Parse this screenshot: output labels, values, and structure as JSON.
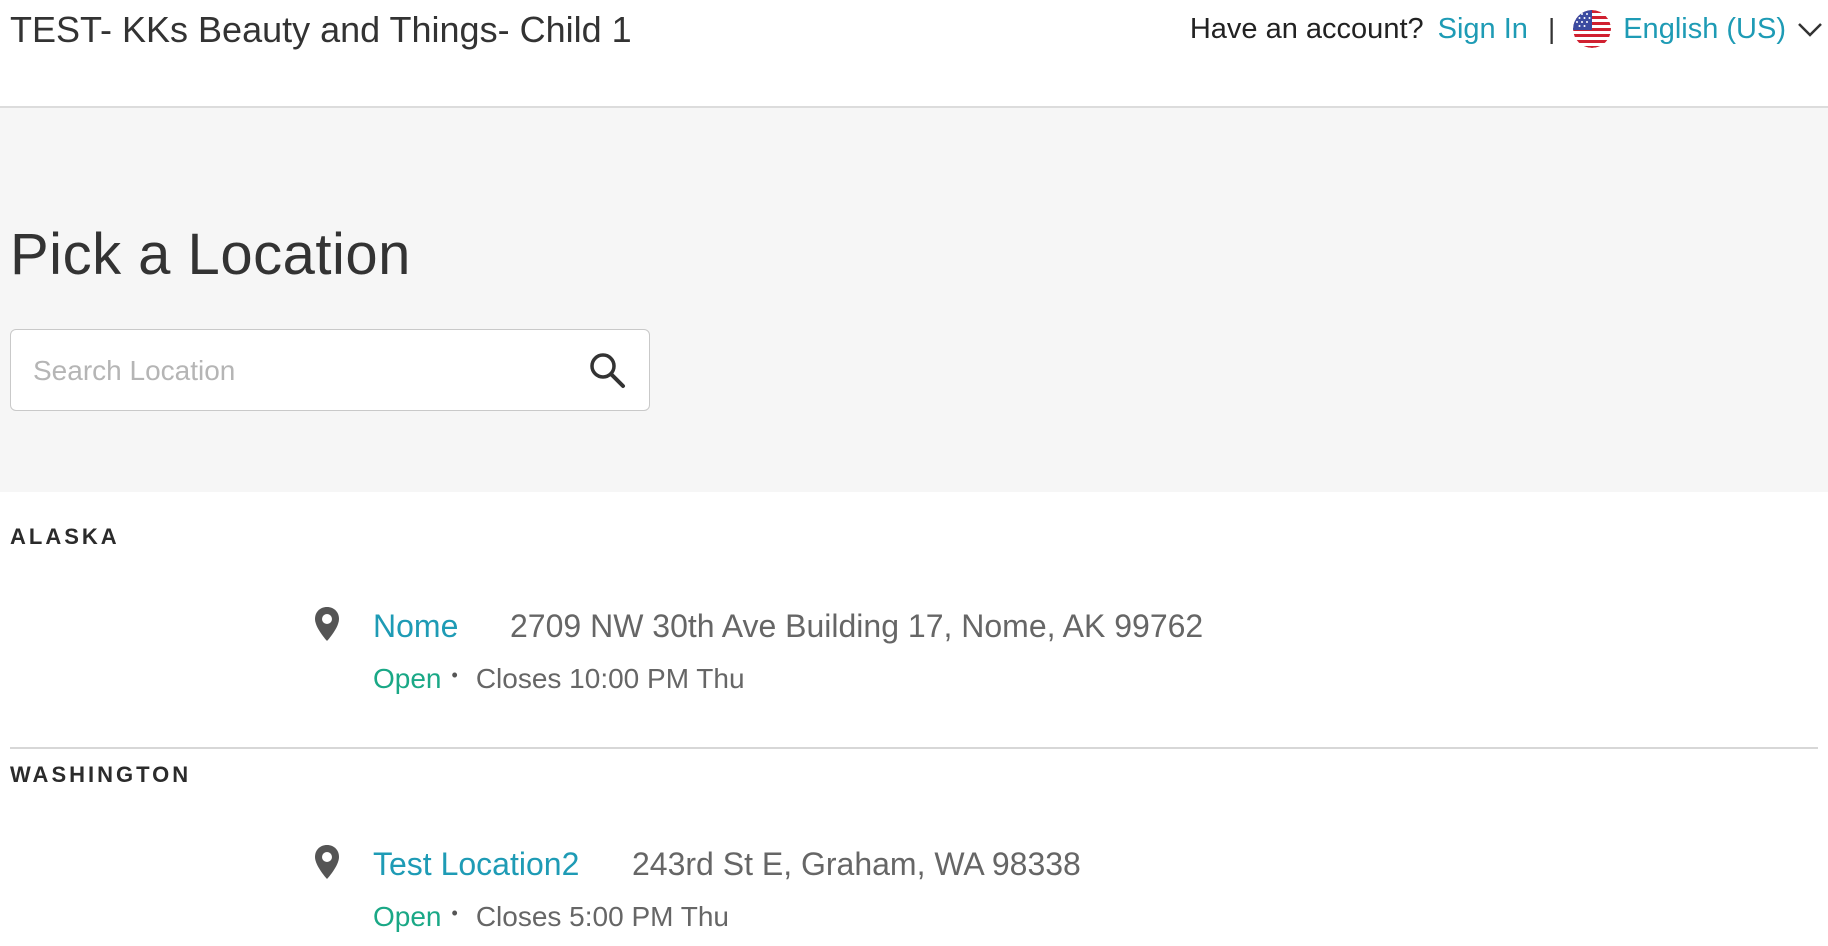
{
  "header": {
    "title": "TEST- KKs Beauty and Things- Child 1",
    "have_account": "Have an account?",
    "sign_in": "Sign In",
    "separator": "|",
    "language": "English (US)",
    "flag_icon": "us-flag-icon",
    "dropdown_icon": "chevron-down-icon"
  },
  "hero": {
    "title": "Pick a Location",
    "search": {
      "placeholder": "Search Location",
      "value": "",
      "icon": "search-icon"
    }
  },
  "regions": [
    {
      "heading": "ALASKA",
      "locations": [
        {
          "icon": "map-pin-icon",
          "name": "Nome",
          "address": "2709 NW 30th Ave Building 17, Nome, AK 99762",
          "status": "Open",
          "separator": "•",
          "closes": "Closes 10:00 PM Thu"
        }
      ]
    },
    {
      "heading": "WASHINGTON",
      "locations": [
        {
          "icon": "map-pin-icon",
          "name": "Test Location2",
          "address": "243rd St E, Graham, WA 98338",
          "status": "Open",
          "separator": "•",
          "closes": "Closes 5:00 PM Thu"
        }
      ]
    }
  ],
  "colors": {
    "accent": "#1e9bb5",
    "open": "#1aa886",
    "hero_bg": "#f6f6f6",
    "text": "#333333"
  }
}
